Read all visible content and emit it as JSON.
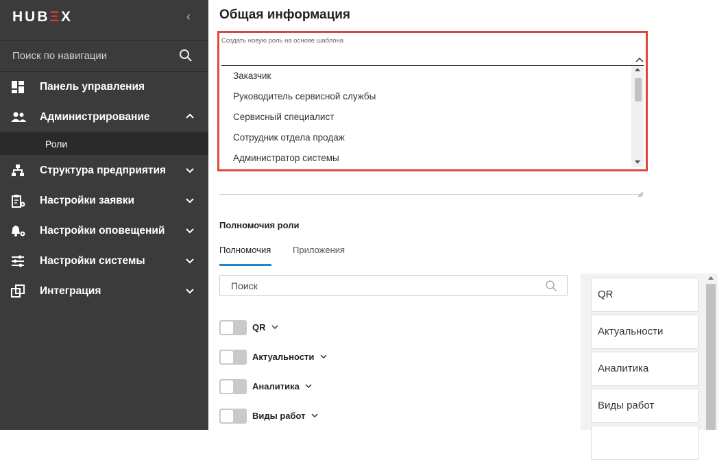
{
  "sidebar": {
    "logo_prefix": "HUB",
    "logo_accent": "Ξ",
    "logo_suffix": "X",
    "collapse_glyph": "‹",
    "search_label": "Поиск по навигации",
    "items": [
      {
        "label": "Панель управления",
        "icon": "dashboard-icon"
      },
      {
        "label": "Администрирование",
        "icon": "users-icon",
        "expanded": true
      },
      {
        "label": "Структура предприятия",
        "icon": "hierarchy-icon"
      },
      {
        "label": "Настройки заявки",
        "icon": "clipboard-gear-icon"
      },
      {
        "label": "Настройки оповещений",
        "icon": "bell-gear-icon"
      },
      {
        "label": "Настройки системы",
        "icon": "sliders-icon"
      },
      {
        "label": "Интеграция",
        "icon": "integration-icon"
      }
    ],
    "subitem": {
      "label": "Роли"
    }
  },
  "main": {
    "title": "Общая информация",
    "template_select": {
      "label": "Создать новую роль на основе шаблона",
      "options": [
        "Заказчик",
        "Руководитель сервисной службы",
        "Сервисный специалист",
        "Сотрудник отдела продаж",
        "Администратор системы"
      ]
    },
    "permissions": {
      "section_title": "Полномочия роли",
      "tabs": [
        {
          "label": "Полномочия",
          "active": true
        },
        {
          "label": "Приложения",
          "active": false
        }
      ],
      "search_placeholder": "Поиск",
      "items": [
        {
          "label": "QR",
          "enabled": false
        },
        {
          "label": "Актуальности",
          "enabled": false
        },
        {
          "label": "Аналитика",
          "enabled": false
        },
        {
          "label": "Виды работ",
          "enabled": false
        }
      ],
      "side_list": [
        "QR",
        "Актуальности",
        "Аналитика",
        "Виды работ"
      ]
    }
  },
  "colors": {
    "sidebar_bg": "#3b3b3b",
    "accent_red": "#e2463a",
    "tab_active": "#1e88c7"
  }
}
